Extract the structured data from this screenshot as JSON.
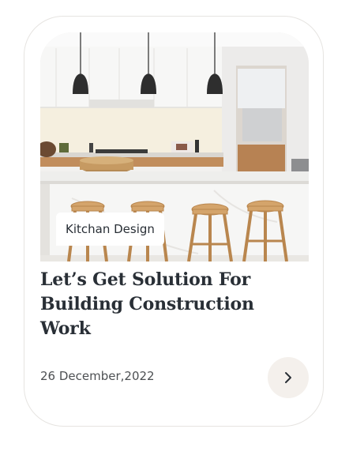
{
  "card": {
    "category": "Kitchan Design",
    "title": "Let’s Get Solution For Building Construction Work",
    "date": "26 December,2022",
    "next_icon": "chevron-right-icon"
  },
  "colors": {
    "heading": "#292f36",
    "text": "#4d5053",
    "button_bg": "#f4f0ec",
    "card_border": "#e6e4e1"
  }
}
